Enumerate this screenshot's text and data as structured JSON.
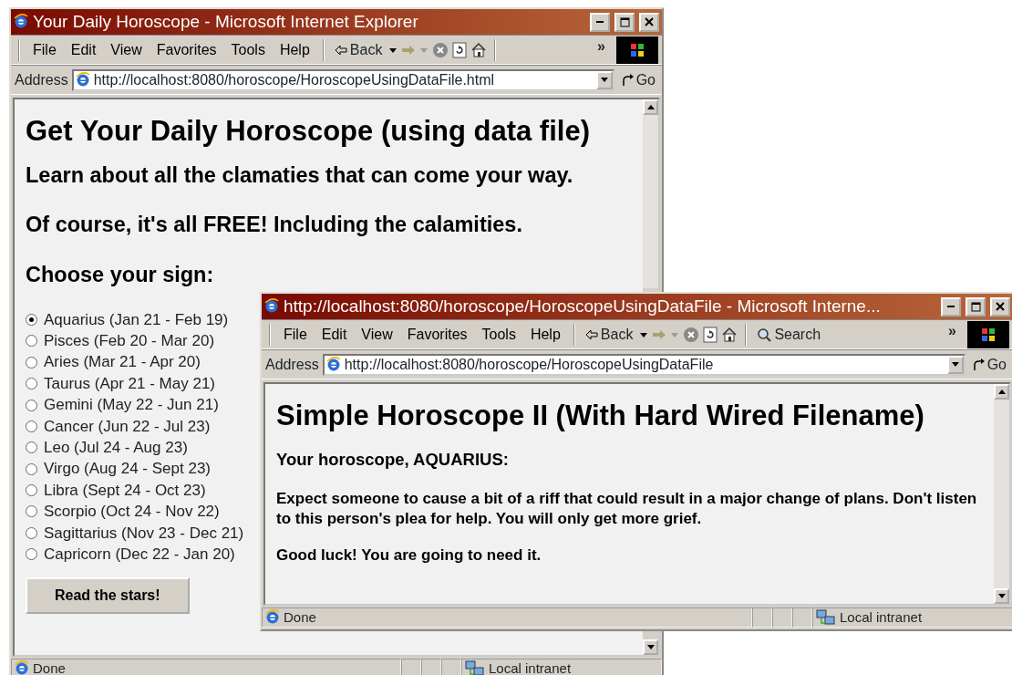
{
  "windows": [
    {
      "title": "Your Daily Horoscope - Microsoft Internet Explorer",
      "menu": [
        "File",
        "Edit",
        "View",
        "Favorites",
        "Tools",
        "Help"
      ],
      "back": "Back",
      "chevron": "»",
      "address_label": "Address",
      "address": "http://localhost:8080/horoscope/HoroscopeUsingDataFile.html",
      "go": "Go",
      "content": [
        {
          "kind": "h1",
          "text": "Get Your Daily Horoscope (using data file)"
        },
        {
          "kind": "h3",
          "text": "Learn about all the clamaties that can come your way."
        },
        {
          "kind": "h3",
          "text": "Of course, it's all FREE! Including the calamities."
        },
        {
          "kind": "h3",
          "text": "Choose your sign:"
        },
        {
          "kind": "radios",
          "options": [
            {
              "label": "Aquarius (Jan 21 - Feb 19)",
              "selected": true
            },
            {
              "label": "Pisces (Feb 20 - Mar 20)",
              "selected": false
            },
            {
              "label": "Aries (Mar 21 - Apr 20)",
              "selected": false
            },
            {
              "label": "Taurus (Apr 21 - May 21)",
              "selected": false
            },
            {
              "label": "Gemini (May 22 - Jun 21)",
              "selected": false
            },
            {
              "label": "Cancer (Jun 22 - Jul 23)",
              "selected": false
            },
            {
              "label": "Leo (Jul 24 - Aug 23)",
              "selected": false
            },
            {
              "label": "Virgo (Aug 24 - Sept 23)",
              "selected": false
            },
            {
              "label": "Libra (Sept 24 - Oct 23)",
              "selected": false
            },
            {
              "label": "Scorpio (Oct 24 - Nov 22)",
              "selected": false
            },
            {
              "label": "Sagittarius (Nov 23 - Dec 21)",
              "selected": false
            },
            {
              "label": "Capricorn (Dec 22 - Jan 20)",
              "selected": false
            }
          ]
        },
        {
          "kind": "button",
          "text": "Read the stars!"
        }
      ],
      "status": "Done",
      "zone": "Local intranet"
    },
    {
      "title": "http://localhost:8080/horoscope/HoroscopeUsingDataFile - Microsoft Interne...",
      "menu": [
        "File",
        "Edit",
        "View",
        "Favorites",
        "Tools",
        "Help"
      ],
      "back": "Back",
      "search": "Search",
      "chevron": "»",
      "address_label": "Address",
      "address": "http://localhost:8080/horoscope/HoroscopeUsingDataFile",
      "go": "Go",
      "content": [
        {
          "kind": "h1",
          "text": "Simple Horoscope II (With Hard Wired Filename)"
        },
        {
          "kind": "h4",
          "text": "Your horoscope, AQUARIUS:"
        },
        {
          "kind": "p",
          "text": "Expect someone to cause a bit of a riff that could result in a major change of plans. Don't listen to this person's plea for help. You will only get more grief."
        },
        {
          "kind": "p",
          "text": "Good luck! You are going to need it."
        }
      ],
      "status": "Done",
      "zone": "Local intranet"
    }
  ]
}
